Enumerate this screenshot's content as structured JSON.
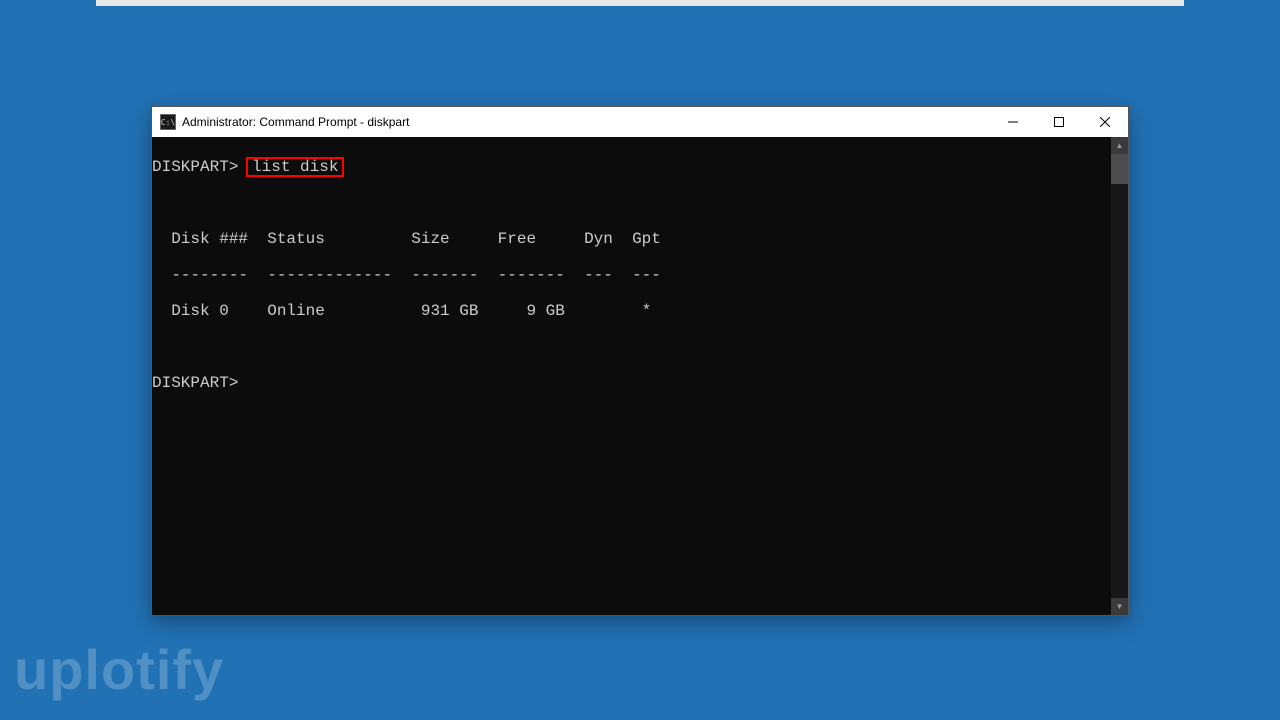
{
  "watermark": "uplotify",
  "window": {
    "title": "Administrator: Command Prompt - diskpart",
    "icon_label": "C:\\"
  },
  "terminal": {
    "prompt1_prefix": "DISKPART>",
    "prompt1_command": "list disk",
    "blank1": "",
    "header": "  Disk ###  Status         Size     Free     Dyn  Gpt",
    "divider": "  --------  -------------  -------  -------  ---  ---",
    "row0": "  Disk 0    Online          931 GB     9 GB        *",
    "blank2": "",
    "prompt2": "DISKPART>"
  },
  "disks": [
    {
      "id": "Disk 0",
      "status": "Online",
      "size": "931 GB",
      "free": "9 GB",
      "dyn": "",
      "gpt": "*"
    }
  ]
}
